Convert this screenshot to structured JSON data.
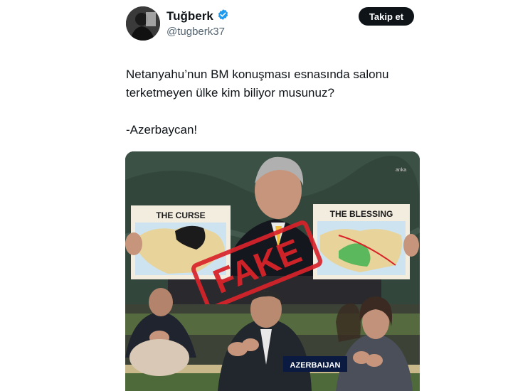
{
  "user": {
    "display_name": "Tuğberk",
    "handle": "@tugberk37",
    "verified": true,
    "verified_color": "#1d9bf0"
  },
  "follow_button": {
    "label": "Takip et"
  },
  "tweet": {
    "line1": "Netanyahu’nun BM konuşması esnasında salonu",
    "line2": "terketmeyen ülke kim biliyor musunuz?",
    "line3": "-Azerbaycan!"
  },
  "media": {
    "watermark": "anka",
    "left_sign": "THE CURSE",
    "right_sign": "THE BLESSING",
    "stamp": "FAKE",
    "nameplate": "AZERBAIJAN",
    "stamp_color": "#d8232a"
  },
  "icons": {
    "verified": "verified-badge-icon"
  }
}
